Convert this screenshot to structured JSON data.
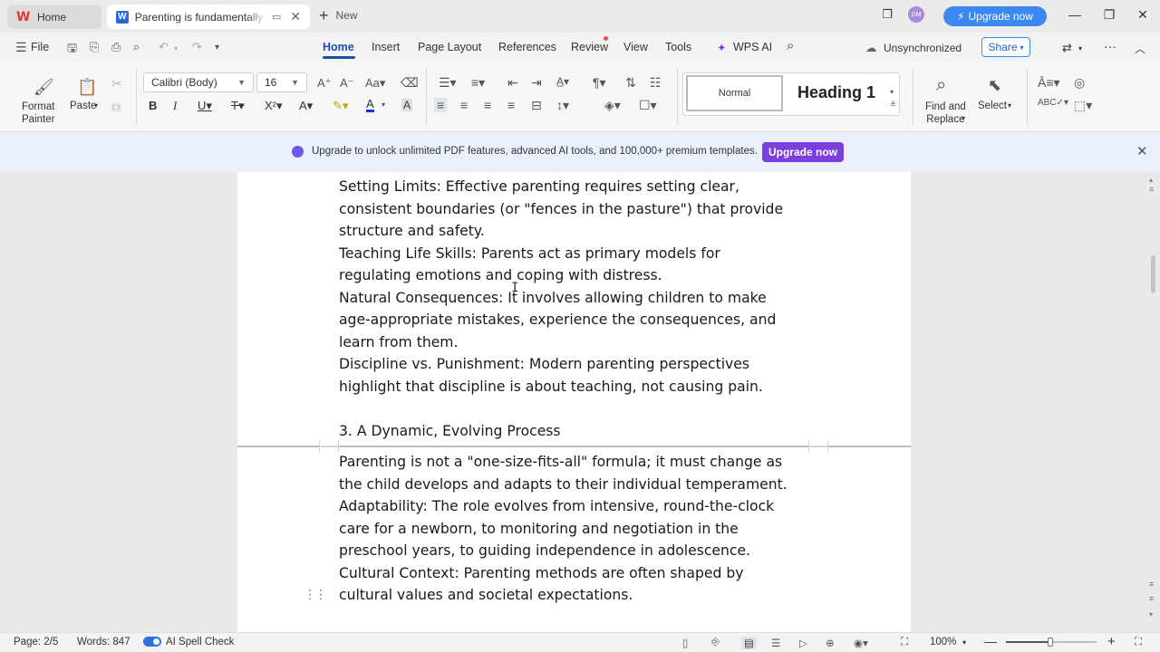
{
  "tabs": {
    "home": "Home",
    "doc": "Parenting is fundamentally th",
    "new": "New"
  },
  "account": {
    "avatar": "DM",
    "upgrade": "Upgrade now"
  },
  "menu": {
    "file": "File",
    "items": [
      "Home",
      "Insert",
      "Page Layout",
      "References",
      "Review",
      "View",
      "Tools",
      "WPS AI"
    ],
    "sync": "Unsynchronized",
    "share": "Share"
  },
  "ribbon": {
    "format_painter": "Format\nPainter",
    "paste": "Paste",
    "font": "Calibri (Body)",
    "size": "16",
    "style_normal": "Normal",
    "style_heading": "Heading 1",
    "find_replace": "Find and\nReplace",
    "select": "Select"
  },
  "banner": {
    "text": "Upgrade to unlock unlimited PDF features, advanced AI tools, and 100,000+ premium templates.",
    "button": "Upgrade now"
  },
  "document": {
    "page1_lines": [
      "Setting Limits: Effective parenting requires setting clear,",
      "consistent boundaries (or \"fences in the pasture\") that provide",
      "structure and safety.",
      "Teaching Life Skills: Parents act as primary models for",
      "regulating emotions and coping with distress.",
      "Natural Consequences: It involves allowing children to make",
      "age-appropriate mistakes, experience the consequences, and",
      "learn from them.",
      "Discipline vs. Punishment: Modern parenting perspectives",
      "highlight that discipline is about teaching, not causing pain."
    ],
    "heading": "3. A Dynamic, Evolving Process",
    "page2_lines": [
      "Parenting is not a \"one-size-fits-all\" formula; it must change as",
      "the child develops and adapts to their individual temperament.",
      "Adaptability: The role evolves from intensive, round-the-clock",
      "care for a newborn, to monitoring and negotiation in the",
      "preschool years, to guiding independence in adolescence.",
      "Cultural Context: Parenting methods are often shaped by",
      "cultural values and societal expectations."
    ]
  },
  "status": {
    "page": "Page: 2/5",
    "words": "Words: 847",
    "spell": "AI Spell Check",
    "zoom": "100%"
  }
}
